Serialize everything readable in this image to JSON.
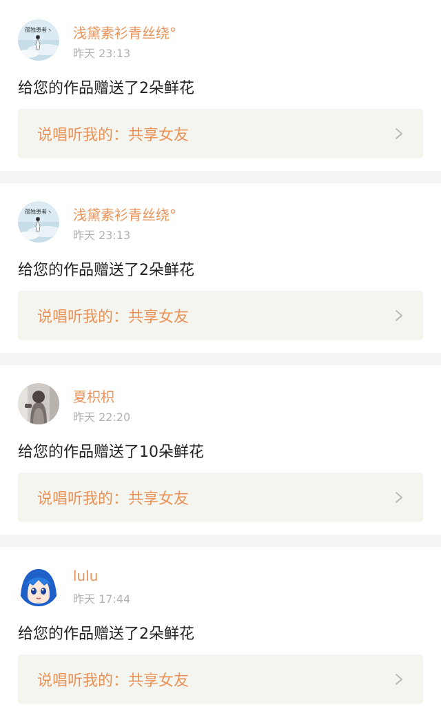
{
  "accent_color": "#e8935a",
  "notifications": [
    {
      "username": "浅黛素衫青丝绕°",
      "time": "昨天 23:13",
      "message": "给您的作品赠送了2朵鲜花",
      "work_title": "说唱听我的：共享女友",
      "avatar_icon": "landscape-avatar-icon",
      "avatar_text": "孤独患者ヽ"
    },
    {
      "username": "浅黛素衫青丝绕°",
      "time": "昨天 23:13",
      "message": "给您的作品赠送了2朵鲜花",
      "work_title": "说唱听我的：共享女友",
      "avatar_icon": "landscape-avatar-icon",
      "avatar_text": "孤独患者ヽ"
    },
    {
      "username": "夏枳枳",
      "time": "昨天 22:20",
      "message": "给您的作品赠送了10朵鲜花",
      "work_title": "说唱听我的：共享女友",
      "avatar_icon": "person-photo-avatar-icon"
    },
    {
      "username": "lulu",
      "time": "昨天 17:44",
      "message": "给您的作品赠送了2朵鲜花",
      "work_title": "说唱听我的：共享女友",
      "avatar_icon": "anime-character-avatar-icon"
    }
  ]
}
